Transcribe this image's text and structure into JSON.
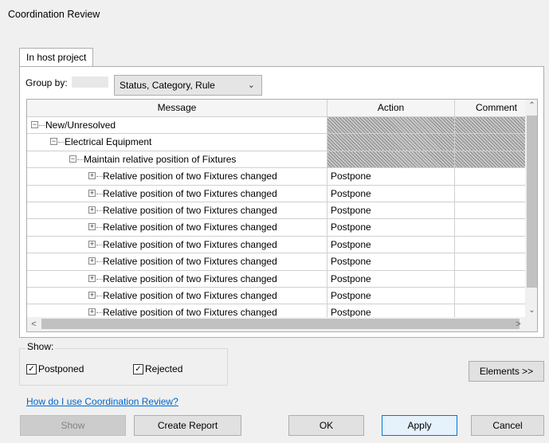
{
  "window": {
    "title": "Coordination Review"
  },
  "tabs": [
    {
      "label": "In host project"
    }
  ],
  "group_by": {
    "label": "Group by:",
    "value": "Status, Category, Rule"
  },
  "grid": {
    "columns": [
      "Message",
      "Action",
      "Comment"
    ],
    "rows": [
      {
        "level": 0,
        "toggle": "minus",
        "message": "New/Unresolved",
        "action": "",
        "hatched": true
      },
      {
        "level": 1,
        "toggle": "minus",
        "message": "Electrical Equipment",
        "action": "",
        "hatched": true
      },
      {
        "level": 2,
        "toggle": "minus",
        "message": "Maintain relative position of Fixtures",
        "action": "",
        "hatched": true
      },
      {
        "level": 3,
        "toggle": "plus",
        "message": "Relative position of two Fixtures changed",
        "action": "Postpone",
        "hatched": false
      },
      {
        "level": 3,
        "toggle": "plus",
        "message": "Relative position of two Fixtures changed",
        "action": "Postpone",
        "hatched": false
      },
      {
        "level": 3,
        "toggle": "plus",
        "message": "Relative position of two Fixtures changed",
        "action": "Postpone",
        "hatched": false
      },
      {
        "level": 3,
        "toggle": "plus",
        "message": "Relative position of two Fixtures changed",
        "action": "Postpone",
        "hatched": false
      },
      {
        "level": 3,
        "toggle": "plus",
        "message": "Relative position of two Fixtures changed",
        "action": "Postpone",
        "hatched": false
      },
      {
        "level": 3,
        "toggle": "plus",
        "message": "Relative position of two Fixtures changed",
        "action": "Postpone",
        "hatched": false
      },
      {
        "level": 3,
        "toggle": "plus",
        "message": "Relative position of two Fixtures changed",
        "action": "Postpone",
        "hatched": false
      },
      {
        "level": 3,
        "toggle": "plus",
        "message": "Relative position of two Fixtures changed",
        "action": "Postpone",
        "hatched": false
      },
      {
        "level": 3,
        "toggle": "plus",
        "message": "Relative position of two Fixtures changed",
        "action": "Postpone",
        "hatched": false
      }
    ]
  },
  "show": {
    "label": "Show:",
    "postponed": {
      "label": "Postponed",
      "checked": true
    },
    "rejected": {
      "label": "Rejected",
      "checked": true
    }
  },
  "help_link": "How do I use Coordination Review?",
  "buttons": {
    "elements": "Elements >>",
    "show": "Show",
    "create_report": "Create Report",
    "ok": "OK",
    "apply": "Apply",
    "cancel": "Cancel"
  },
  "colors": {
    "accent": "#0078d7",
    "link": "#0066cc"
  }
}
